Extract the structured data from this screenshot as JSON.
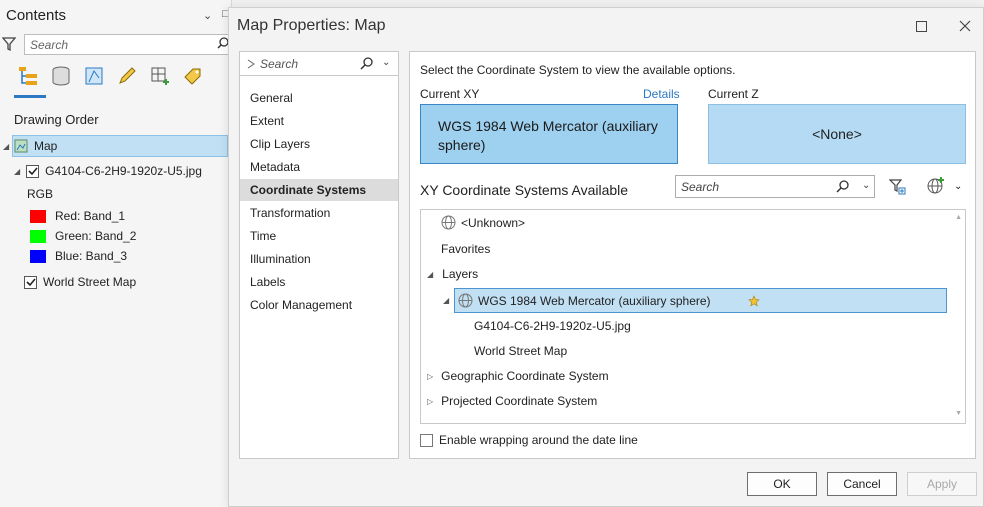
{
  "contents": {
    "title": "Contents",
    "search_placeholder": "Search",
    "drawing_order": "Drawing Order",
    "tree": {
      "map": "Map",
      "layer1": "G4104-C6-2H9-1920z-U5.jpg",
      "rgb": "RGB",
      "bands": [
        {
          "label": "Red:  Band_1",
          "color": "#ff0000"
        },
        {
          "label": "Green: Band_2",
          "color": "#00ff00"
        },
        {
          "label": "Blue:  Band_3",
          "color": "#0000ff"
        }
      ],
      "layer2": "World Street Map"
    }
  },
  "dialog": {
    "title": "Map Properties: Map",
    "nav_search_placeholder": "Search",
    "nav_items": [
      "General",
      "Extent",
      "Clip Layers",
      "Metadata",
      "Coordinate Systems",
      "Transformation",
      "Time",
      "Illumination",
      "Labels",
      "Color Management"
    ],
    "nav_active": "Coordinate Systems",
    "instructions": "Select the Coordinate System to view the available options.",
    "current_xy_label": "Current XY",
    "details_link": "Details",
    "current_z_label": "Current Z",
    "current_xy_value": "WGS 1984 Web Mercator (auxiliary sphere)",
    "current_z_value": "<None>",
    "available_label": "XY Coordinate Systems Available",
    "available_search_placeholder": "Search",
    "tree": {
      "unknown": "<Unknown>",
      "favorites": "Favorites",
      "layers": "Layers",
      "selected_cs": "WGS 1984 Web Mercator (auxiliary sphere)",
      "layer1": "G4104-C6-2H9-1920z-U5.jpg",
      "layer2": "World Street Map",
      "geographic": "Geographic Coordinate System",
      "projected": "Projected Coordinate System"
    },
    "wrap_label": "Enable wrapping around the date line",
    "buttons": {
      "ok": "OK",
      "cancel": "Cancel",
      "apply": "Apply"
    }
  },
  "colors": {
    "accent": "#2b79c2",
    "selection": "#c2e0f4",
    "xy_box": "#9ed0f0"
  }
}
